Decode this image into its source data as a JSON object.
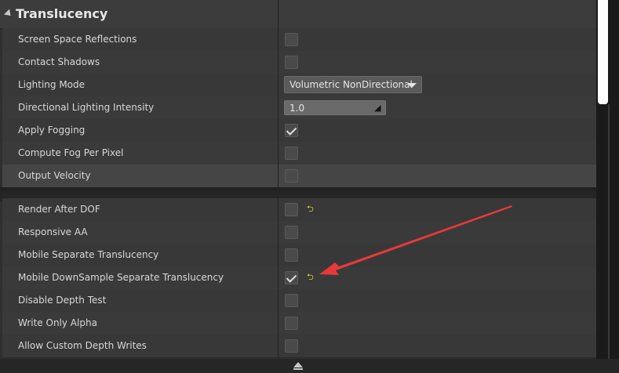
{
  "section": {
    "title": "Translucency"
  },
  "rows_top": [
    {
      "label": "Screen Space Reflections",
      "type": "checkbox",
      "checked": false
    },
    {
      "label": "Contact Shadows",
      "type": "checkbox",
      "checked": false
    },
    {
      "label": "Lighting Mode",
      "type": "dropdown",
      "value": "Volumetric NonDirectional"
    },
    {
      "label": "Directional Lighting Intensity",
      "type": "number",
      "value": "1.0"
    },
    {
      "label": "Apply Fogging",
      "type": "checkbox",
      "checked": true
    },
    {
      "label": "Compute Fog Per Pixel",
      "type": "checkbox",
      "checked": false
    },
    {
      "label": "Output Velocity",
      "type": "checkbox",
      "checked": false
    }
  ],
  "rows_advanced": [
    {
      "label": "Render After DOF",
      "type": "checkbox",
      "checked": false,
      "reset_to_default": true
    },
    {
      "label": "Responsive AA",
      "type": "checkbox",
      "checked": false
    },
    {
      "label": "Mobile Separate Translucency",
      "type": "checkbox",
      "checked": false
    },
    {
      "label": "Mobile DownSample Separate Translucency",
      "type": "checkbox",
      "checked": true,
      "reset_to_default": true
    },
    {
      "label": "Disable Depth Test",
      "type": "checkbox",
      "checked": false
    },
    {
      "label": "Write Only Alpha",
      "type": "checkbox",
      "checked": false
    },
    {
      "label": "Allow Custom Depth Writes",
      "type": "checkbox",
      "checked": false
    }
  ],
  "icons": {
    "collapse": "collapse-triangle-icon",
    "reset": "reset-to-default-icon",
    "dropdown": "chevron-down-icon",
    "resize": "resize-grip-icon",
    "advanced_toggle": "collapse-advanced-icon"
  },
  "colors": {
    "panel_bg": "#2f2f2f",
    "row_bg": "#383838",
    "reset_icon": "#d7cf3b",
    "annotation_arrow": "#e8393a"
  }
}
